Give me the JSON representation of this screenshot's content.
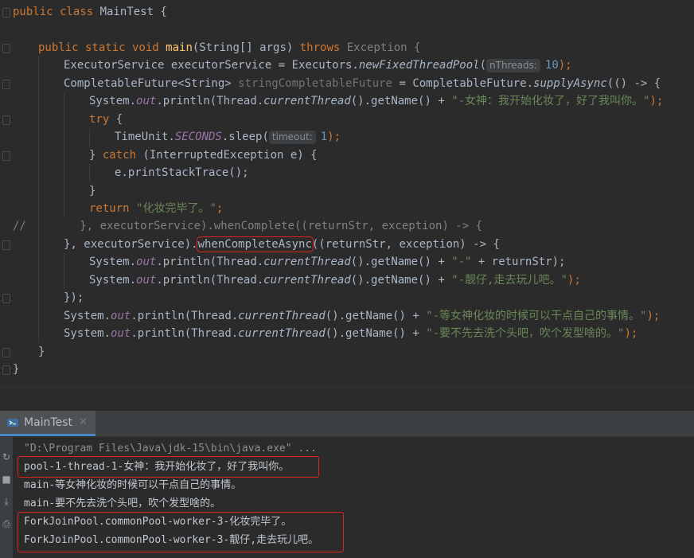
{
  "editor": {
    "lines": [
      {
        "indent": 0,
        "segments": [
          {
            "t": "public class ",
            "c": "kw"
          },
          {
            "t": "MainTest {",
            "c": "plain"
          }
        ]
      },
      {
        "indent": 0,
        "segments": []
      },
      {
        "indent": 1,
        "segments": [
          {
            "t": "public static void ",
            "c": "kw"
          },
          {
            "t": "main",
            "c": "fn"
          },
          {
            "t": "(String[] args) ",
            "c": "plain"
          },
          {
            "t": "throws ",
            "c": "kw"
          },
          {
            "t": "Exception {",
            "c": "plain-dim"
          }
        ]
      },
      {
        "indent": 2,
        "segments": [
          {
            "t": "ExecutorService executorService = Executors.",
            "c": "plain"
          },
          {
            "t": "newFixedThreadPool",
            "c": "static"
          },
          {
            "t": "(",
            "c": "plain"
          },
          {
            "hint": "nThreads:"
          },
          {
            "t": "10",
            "c": "num"
          },
          {
            "t": ");",
            "c": "kw"
          }
        ]
      },
      {
        "indent": 2,
        "segments": [
          {
            "t": "CompletableFuture<String> ",
            "c": "plain"
          },
          {
            "t": "stringCompletableFuture",
            "c": "unused"
          },
          {
            "t": " = CompletableFuture.",
            "c": "plain"
          },
          {
            "t": "supplyAsync",
            "c": "static"
          },
          {
            "t": "(() -> {",
            "c": "plain"
          }
        ]
      },
      {
        "indent": 3,
        "segments": [
          {
            "t": "System.",
            "c": "plain"
          },
          {
            "t": "out",
            "c": "field"
          },
          {
            "t": ".println(Thread.",
            "c": "plain"
          },
          {
            "t": "currentThread",
            "c": "static"
          },
          {
            "t": "().getName() + ",
            "c": "plain"
          },
          {
            "t": "\"-女神：我开始化妆了，好了我叫你。\"",
            "c": "str"
          },
          {
            "t": ");",
            "c": "kw"
          }
        ]
      },
      {
        "indent": 3,
        "segments": [
          {
            "t": "try ",
            "c": "kw"
          },
          {
            "t": "{",
            "c": "plain"
          }
        ]
      },
      {
        "indent": 4,
        "segments": [
          {
            "t": "TimeUnit.",
            "c": "plain"
          },
          {
            "t": "SECONDS",
            "c": "field"
          },
          {
            "t": ".sleep(",
            "c": "plain"
          },
          {
            "hint": "timeout:"
          },
          {
            "t": "1",
            "c": "num"
          },
          {
            "t": ");",
            "c": "kw"
          }
        ]
      },
      {
        "indent": 3,
        "segments": [
          {
            "t": "} ",
            "c": "plain"
          },
          {
            "t": "catch ",
            "c": "kw"
          },
          {
            "t": "(InterruptedException e) {",
            "c": "plain"
          }
        ]
      },
      {
        "indent": 4,
        "segments": [
          {
            "t": "e.printStackTrace();",
            "c": "plain"
          }
        ]
      },
      {
        "indent": 3,
        "segments": [
          {
            "t": "}",
            "c": "plain"
          }
        ]
      },
      {
        "indent": 3,
        "segments": [
          {
            "t": "return ",
            "c": "kw"
          },
          {
            "t": "\"化妆完毕了。\"",
            "c": "str"
          },
          {
            "t": ";",
            "c": "kw"
          }
        ]
      },
      {
        "indent": 0,
        "segments": [
          {
            "t": "//        }, executorService).whenComplete((returnStr, exception) -> {",
            "c": "comment"
          }
        ]
      },
      {
        "indent": 2,
        "segments": [
          {
            "t": "}, executorService).",
            "c": "plain"
          },
          {
            "t": "whenCompleteAsync",
            "c": "plain",
            "box": true
          },
          {
            "t": "((returnStr, exception) -> {",
            "c": "plain"
          }
        ]
      },
      {
        "indent": 3,
        "segments": [
          {
            "t": "System.",
            "c": "plain"
          },
          {
            "t": "out",
            "c": "field"
          },
          {
            "t": ".println(Thread.",
            "c": "plain"
          },
          {
            "t": "currentThread",
            "c": "static"
          },
          {
            "t": "().getName() + ",
            "c": "plain"
          },
          {
            "t": "\"-\"",
            "c": "str"
          },
          {
            "t": " + returnStr);",
            "c": "plain"
          }
        ]
      },
      {
        "indent": 3,
        "segments": [
          {
            "t": "System.",
            "c": "plain"
          },
          {
            "t": "out",
            "c": "field"
          },
          {
            "t": ".println(Thread.",
            "c": "plain"
          },
          {
            "t": "currentThread",
            "c": "static"
          },
          {
            "t": "().getName() + ",
            "c": "plain"
          },
          {
            "t": "\"-靓仔,走去玩儿吧。\"",
            "c": "str"
          },
          {
            "t": ");",
            "c": "kw"
          }
        ]
      },
      {
        "indent": 2,
        "segments": [
          {
            "t": "});",
            "c": "plain"
          }
        ]
      },
      {
        "indent": 2,
        "segments": [
          {
            "t": "System.",
            "c": "plain"
          },
          {
            "t": "out",
            "c": "field"
          },
          {
            "t": ".println(Thread.",
            "c": "plain"
          },
          {
            "t": "currentThread",
            "c": "static"
          },
          {
            "t": "().getName() + ",
            "c": "plain"
          },
          {
            "t": "\"-等女神化妆的时候可以干点自己的事情。\"",
            "c": "str"
          },
          {
            "t": ");",
            "c": "kw"
          }
        ]
      },
      {
        "indent": 2,
        "segments": [
          {
            "t": "System.",
            "c": "plain"
          },
          {
            "t": "out",
            "c": "field"
          },
          {
            "t": ".println(Thread.",
            "c": "plain"
          },
          {
            "t": "currentThread",
            "c": "static"
          },
          {
            "t": "().getName() + ",
            "c": "plain"
          },
          {
            "t": "\"-要不先去洗个头吧，吹个发型啥的。\"",
            "c": "str"
          },
          {
            "t": ");",
            "c": "kw"
          }
        ]
      },
      {
        "indent": 1,
        "segments": [
          {
            "t": "}",
            "c": "plain"
          }
        ]
      },
      {
        "indent": 0,
        "segments": [
          {
            "t": "}",
            "c": "plain"
          }
        ]
      }
    ]
  },
  "run_panel": {
    "tab_label": "MainTest",
    "tab_icon": "run-config-icon",
    "close_icon": "close-icon",
    "console": [
      {
        "text": "\"D:\\Program Files\\Java\\jdk-15\\bin\\java.exe\" ...",
        "muted": true
      },
      {
        "text": "pool-1-thread-1-女神：我开始化妆了，好了我叫你。",
        "muted": false
      },
      {
        "text": "main-等女神化妆的时候可以干点自己的事情。",
        "muted": false
      },
      {
        "text": "main-要不先去洗个头吧，吹个发型啥的。",
        "muted": false
      },
      {
        "text": "ForkJoinPool.commonPool-worker-3-化妆完毕了。",
        "muted": false
      },
      {
        "text": "ForkJoinPool.commonPool-worker-3-靓仔,走去玩儿吧。",
        "muted": false
      }
    ],
    "toolstrip_icons": [
      "rerun-icon",
      "stop-icon",
      "scroll-to-end-icon",
      "print-icon"
    ]
  },
  "colors": {
    "kw": "#cc7832",
    "plain": "#a9b7c6",
    "plain-dim": "#808080",
    "fn": "#ffc66d",
    "static": "#a9b7c6",
    "field": "#9876aa",
    "num": "#6897bb",
    "str": "#6a8759",
    "unused": "#72737a",
    "comment": "#808080",
    "highlight_box": "#e0221c"
  }
}
